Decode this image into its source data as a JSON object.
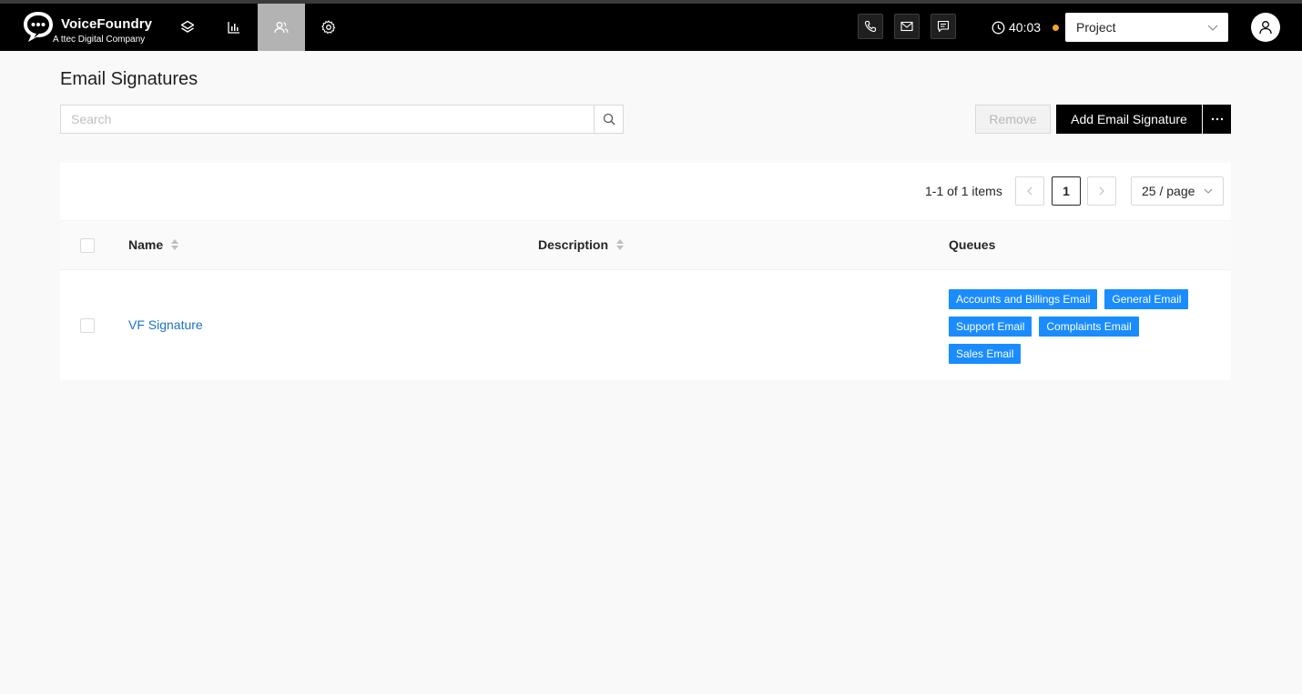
{
  "brand": {
    "name": "VoiceFoundry",
    "subtitle": "A ttec Digital Company"
  },
  "nav": {
    "items": [
      {
        "icon": "layers-icon"
      },
      {
        "icon": "bar-chart-icon"
      },
      {
        "icon": "users-icon",
        "active": true
      },
      {
        "icon": "gear-icon"
      }
    ]
  },
  "channels": [
    "phone-icon",
    "mail-icon",
    "chat-icon"
  ],
  "status": {
    "timer": "40:03",
    "dot_color": "#f5a623"
  },
  "project_select": {
    "value": "Project"
  },
  "page": {
    "title": "Email Signatures"
  },
  "search": {
    "placeholder": "Search"
  },
  "actions": {
    "remove_label": "Remove",
    "add_label": "Add Email Signature",
    "more_label": "···"
  },
  "pagination": {
    "total_text": "1-1 of 1 items",
    "prev": "<",
    "current": "1",
    "next": ">",
    "page_size": "25 / page"
  },
  "table": {
    "columns": {
      "name": "Name",
      "description": "Description",
      "queues": "Queues"
    },
    "rows": [
      {
        "name": "VF Signature",
        "description": "",
        "queues": [
          "Accounts and Billings Email",
          "General Email",
          "Support Email",
          "Complaints Email",
          "Sales Email"
        ]
      }
    ]
  },
  "colors": {
    "accent_link": "#1a73c8",
    "tag_bg": "#1a8cff",
    "nav_bg": "#000000"
  }
}
